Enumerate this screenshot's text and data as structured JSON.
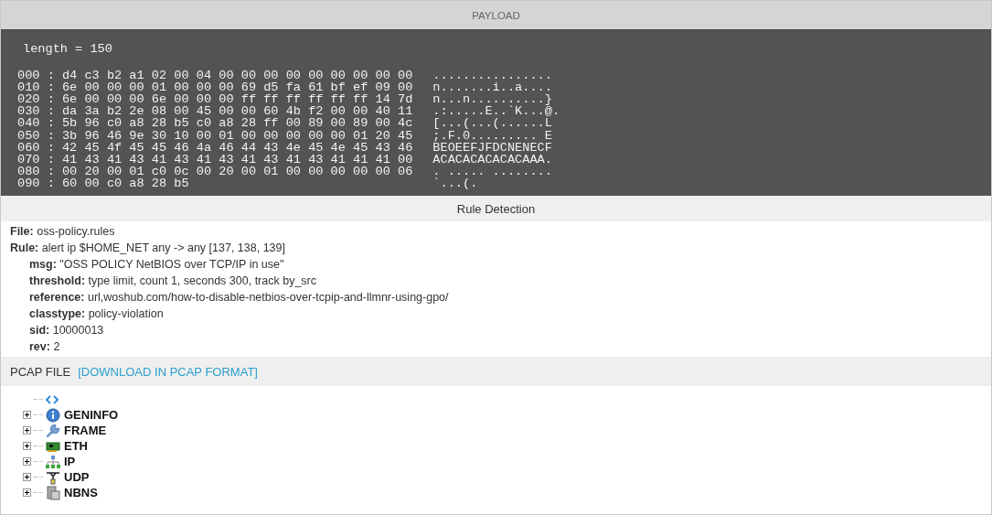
{
  "payload": {
    "title": "PAYLOAD",
    "length_line": "length = 150",
    "hex_lines": [
      "000 : d4 c3 b2 a1 02 00 04 00 00 00 00 00 00 00 00 00",
      "010 : 6e 00 00 00 01 00 00 00 69 d5 fa 61 bf ef 09 00",
      "020 : 6e 00 00 00 6e 00 00 00 ff ff ff ff ff ff 14 7d",
      "030 : da 3a b2 2e 08 00 45 00 00 60 4b f2 00 00 40 11",
      "040 : 5b 96 c0 a8 28 b5 c0 a8 28 ff 00 89 00 89 00 4c",
      "050 : 3b 96 46 9e 30 10 00 01 00 00 00 00 00 01 20 45",
      "060 : 42 45 4f 45 45 46 4a 46 44 43 4e 45 4e 45 43 46",
      "070 : 41 43 41 43 41 43 41 43 41 43 41 43 41 41 41 00",
      "080 : 00 20 00 01 c0 0c 00 20 00 01 00 00 00 00 00 06",
      "090 : 60 00 c0 a8 28 b5"
    ],
    "ascii_lines": [
      "................",
      "n.......i..a....",
      "n...n..........}",
      ".:.....E..`K...@.",
      "[...(...(......L",
      ";.F.0......... E",
      "BEOEEFJFDCNENECF",
      "ACACACACACACAAA.",
      ". ..... ........",
      "`...(."
    ]
  },
  "rule_detection": {
    "title": "Rule Detection",
    "lines": [
      {
        "key": "File:",
        "value": "oss-policy.rules",
        "indented": false
      },
      {
        "key": "Rule:",
        "value": "alert ip $HOME_NET any -> any [137, 138, 139]",
        "indented": false
      },
      {
        "key": "msg:",
        "value": "\"OSS POLICY NetBIOS over TCP/IP in use\"",
        "indented": true
      },
      {
        "key": "threshold:",
        "value": "type limit, count 1, seconds 300, track by_src",
        "indented": true
      },
      {
        "key": "reference:",
        "value": "url,woshub.com/how-to-disable-netbios-over-tcpip-and-llmnr-using-gpo/",
        "indented": true
      },
      {
        "key": "classtype:",
        "value": "policy-violation",
        "indented": true
      },
      {
        "key": "sid:",
        "value": "10000013",
        "indented": true
      },
      {
        "key": "rev:",
        "value": "2",
        "indented": true
      }
    ]
  },
  "pcap": {
    "title": "PCAP FILE",
    "download_link": "[DOWNLOAD IN PCAP FORMAT]",
    "tree": [
      {
        "kind": "root"
      },
      {
        "kind": "info",
        "label": "GENINFO",
        "expanded": false
      },
      {
        "kind": "wrench",
        "label": "FRAME",
        "expanded": false
      },
      {
        "kind": "card",
        "label": "ETH",
        "expanded": false
      },
      {
        "kind": "network",
        "label": "IP",
        "expanded": false
      },
      {
        "kind": "plug",
        "label": "UDP",
        "expanded": false
      },
      {
        "kind": "server",
        "label": "NBNS",
        "expanded": false
      }
    ]
  }
}
